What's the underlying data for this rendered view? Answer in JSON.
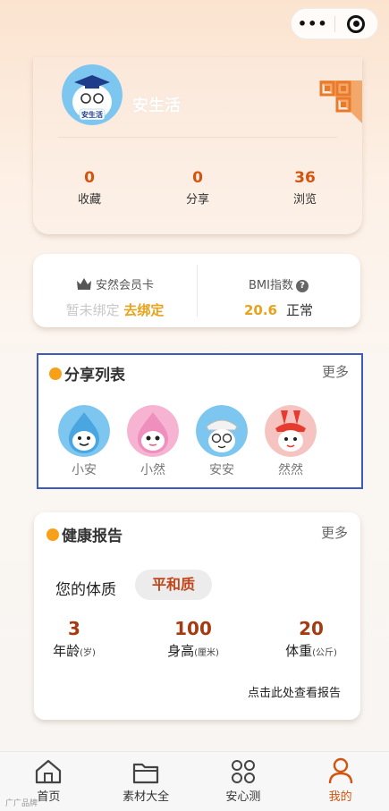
{
  "capsule": {
    "more_icon": "more-dots-icon",
    "close_icon": "target-icon"
  },
  "profile": {
    "avatar_text": "安生活",
    "name": "安生活",
    "stats": [
      {
        "value": "0",
        "label": "收藏"
      },
      {
        "value": "0",
        "label": "分享"
      },
      {
        "value": "36",
        "label": "浏览"
      }
    ]
  },
  "membership": {
    "title": "安然会员卡",
    "status": "暂未绑定",
    "action": "去绑定",
    "bmi_title": "BMI指数",
    "bmi_help": "?",
    "bmi_value": "20.6",
    "bmi_status": "正常"
  },
  "share_list": {
    "title": "分享列表",
    "more": "更多",
    "members": [
      {
        "name": "小安"
      },
      {
        "name": "小然"
      },
      {
        "name": "安安"
      },
      {
        "name": "然然"
      }
    ]
  },
  "health_report": {
    "title": "健康报告",
    "more": "更多",
    "constitution_label": "您的体质",
    "constitution_value": "平和质",
    "metrics": [
      {
        "value": "3",
        "label": "年龄",
        "unit": "(岁)"
      },
      {
        "value": "100",
        "label": "身高",
        "unit": "(厘米)"
      },
      {
        "value": "20",
        "label": "体重",
        "unit": "(公斤)"
      }
    ],
    "report_link": "点击此处查看报告"
  },
  "tabbar": [
    {
      "label": "首页",
      "icon": "home-icon"
    },
    {
      "label": "素材大全",
      "icon": "folder-icon"
    },
    {
      "label": "安心测",
      "icon": "grid-icon"
    },
    {
      "label": "我的",
      "icon": "person-icon",
      "active": true
    }
  ],
  "colors": {
    "accent": "#d2540f",
    "gold": "#e8a21b",
    "highlight_border": "#3b5bc0"
  },
  "watermark": "广广品牌"
}
